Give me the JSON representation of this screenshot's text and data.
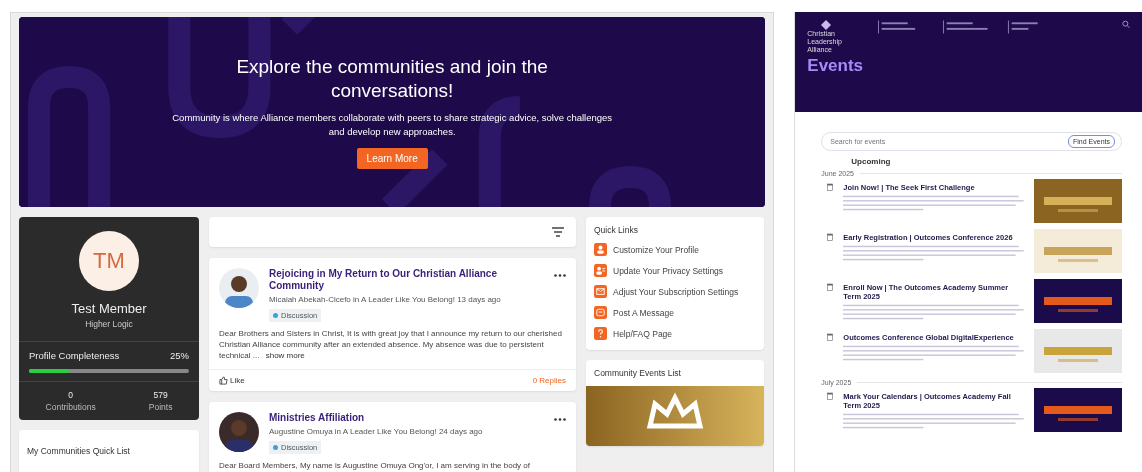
{
  "community_page": {
    "hero": {
      "title": "Explore the communities and join the conversations!",
      "text": "Community is where Alliance members collaborate with peers to share strategic advice, solve challenges and develop new approaches.",
      "button": "Learn More"
    },
    "profile": {
      "initials": "TM",
      "name": "Test Member",
      "organization": "Higher Logic",
      "completeness_label": "Profile Completeness",
      "completeness_value": "25%",
      "level": 0.25,
      "stats": [
        {
          "value": "0",
          "label": "Contributions"
        },
        {
          "value": "579",
          "label": "Points"
        }
      ]
    },
    "communities_card": {
      "title": "My Communities Quick List"
    },
    "posts": [
      {
        "title": "Rejoicing in My Return to Our Christian Alliance Community",
        "meta": "Micaiah Abekah-Cicefo in A Leader Like You Belong! 13 days ago",
        "tag": "Discussion",
        "body": "Dear Brothers and Sisters in Christ, It is with great joy that I announce my return to our cherished Christian Alliance community after an extended absence. My absence was due to persistent technical ...",
        "show_more": "show more",
        "like": "Like",
        "replies": "0 Replies"
      },
      {
        "title": "Ministries Affiliation",
        "meta": "Augustine Omuya in A Leader Like You Belong! 24 days ago",
        "tag": "Discussion",
        "body": "Dear Board Members, My name is Augustine Omuya Ong'or, I am serving in the body of"
      }
    ],
    "quick_links": {
      "title": "Quick Links",
      "items": [
        {
          "label": "Customize Your Profile"
        },
        {
          "label": "Update Your Privacy Settings"
        },
        {
          "label": "Adjust Your Subscription Settings"
        },
        {
          "label": "Post A Message"
        },
        {
          "label": "Help/FAQ Page"
        }
      ]
    },
    "events_widget": {
      "title": "Community Events List"
    }
  },
  "events_page": {
    "logo": "Christian Leadership Alliance",
    "title": "Events",
    "search_placeholder": "Search for events",
    "find_button": "Find Events",
    "heading": "Upcoming",
    "months": [
      {
        "label": "June 2025",
        "events": [
          {
            "title": "Join Now! | The Seek First Challenge"
          },
          {
            "title": "Early Registration | Outcomes Conference 2026"
          },
          {
            "title": "Enroll Now | The Outcomes Academy Summer Term 2025"
          },
          {
            "title": "Outcomes Conference Global DigitalExperience"
          }
        ]
      },
      {
        "label": "July 2025",
        "events": [
          {
            "title": "Mark Your Calendars | Outcomes Academy Fall Term 2025"
          }
        ]
      }
    ]
  }
}
